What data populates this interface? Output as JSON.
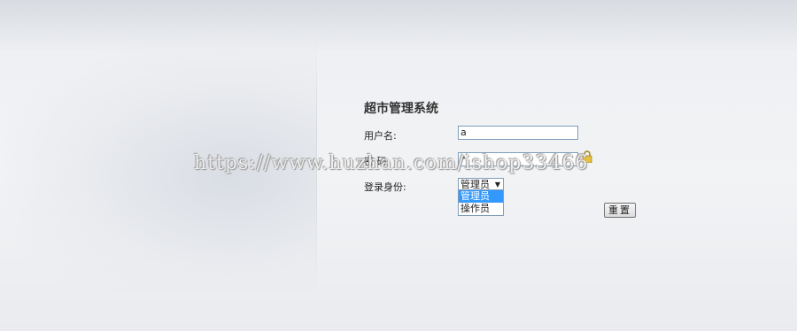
{
  "app": {
    "title": "超市管理系统"
  },
  "form": {
    "username_label": "用户名:",
    "username_value": "a",
    "password_label": "密 码:",
    "password_mask": "•",
    "role_label": "登录身份:",
    "role_selected": "管理员",
    "role_options": [
      "管理员",
      "操作员"
    ],
    "reset_label": "重置"
  },
  "watermark": {
    "text": "https://www.huzhan.com/ishop33466"
  },
  "icons": {
    "lock": "lock-icon",
    "dropdown": "chevron-down-icon"
  }
}
